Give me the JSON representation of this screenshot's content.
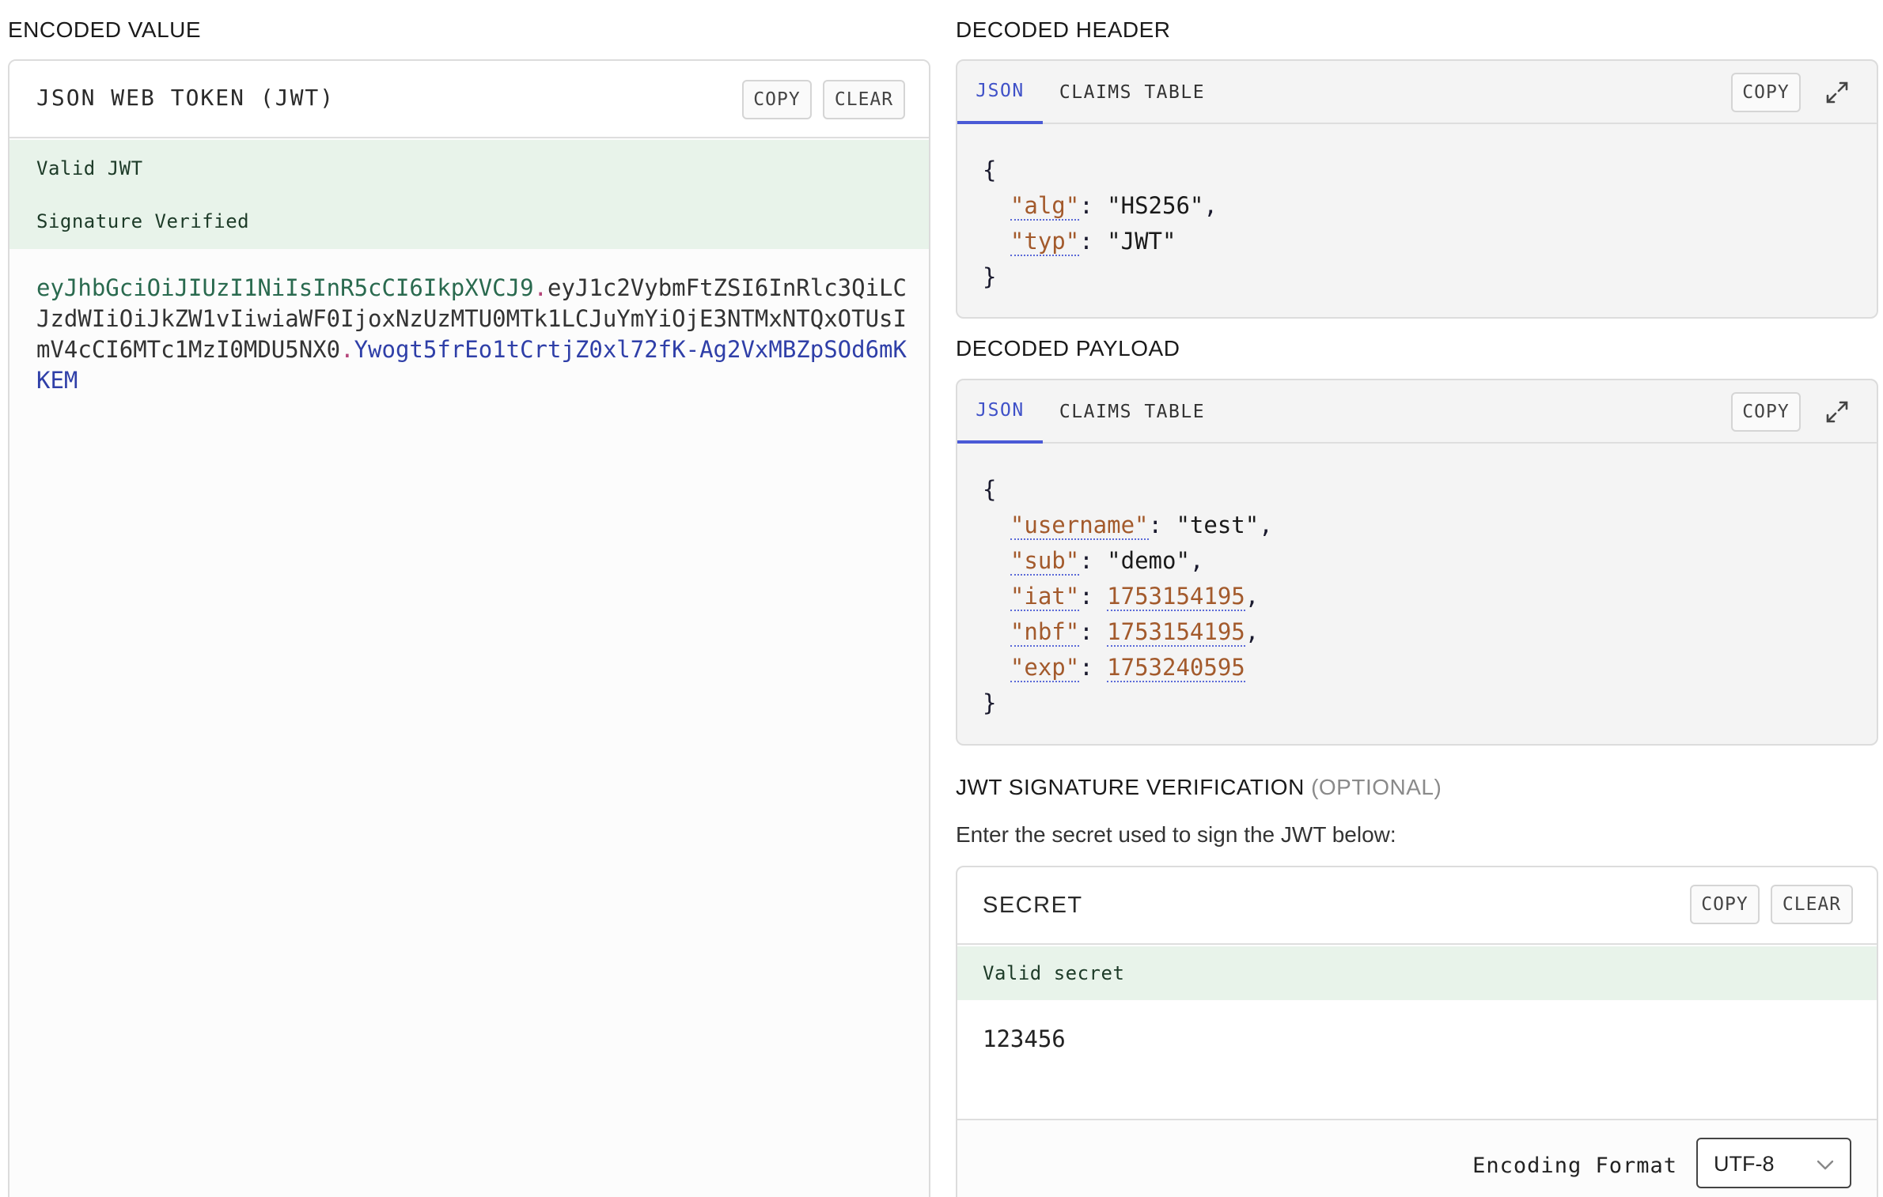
{
  "encoded": {
    "section_title": "ENCODED VALUE",
    "panel_title": "JSON WEB TOKEN (JWT)",
    "copy_label": "COPY",
    "clear_label": "CLEAR",
    "status_valid": "Valid JWT",
    "status_signature": "Signature Verified",
    "token_header": "eyJhbGciOiJIUzI1NiIsInR5cCI6IkpXVCJ9",
    "token_payload": "eyJ1c2VybmFtZSI6InRlc3QiLCJzdWIiOiJkZW1vIiwiaWF0IjoxNzUzMTU0MTk1LCJuYmYiOjE3NTMxNTQxOTUsImV4cCI6MTc1MzI0MDU5NX0",
    "token_signature": "Ywogt5frEo1tCrtjZ0xl72fK-Ag2VxMBZpSOd6mKKEM",
    "dot": "."
  },
  "header": {
    "section_title": "DECODED HEADER",
    "tab_json": "JSON",
    "tab_claims": "CLAIMS TABLE",
    "copy_label": "COPY",
    "open_brace": "{",
    "close_brace": "}",
    "fields": [
      {
        "key": "\"alg\"",
        "value": "\"HS256\"",
        "sep": ": ",
        "end": ","
      },
      {
        "key": "\"typ\"",
        "value": "\"JWT\"",
        "sep": ": ",
        "end": ""
      }
    ]
  },
  "payload": {
    "section_title": "DECODED PAYLOAD",
    "tab_json": "JSON",
    "tab_claims": "CLAIMS TABLE",
    "copy_label": "COPY",
    "open_brace": "{",
    "close_brace": "}",
    "fields": [
      {
        "key": "\"username\"",
        "value": "\"test\"",
        "sep": ": ",
        "end": ","
      },
      {
        "key": "\"sub\"",
        "value": "\"demo\"",
        "sep": ": ",
        "end": ","
      },
      {
        "key": "\"iat\"",
        "value": "1753154195",
        "sep": ": ",
        "end": ","
      },
      {
        "key": "\"nbf\"",
        "value": "1753154195",
        "sep": ": ",
        "end": ","
      },
      {
        "key": "\"exp\"",
        "value": "1753240595",
        "sep": ": ",
        "end": ""
      }
    ]
  },
  "verification": {
    "title": "JWT SIGNATURE VERIFICATION",
    "optional": "(OPTIONAL)",
    "instruction": "Enter the secret used to sign the JWT below:",
    "panel_title": "SECRET",
    "copy_label": "COPY",
    "clear_label": "CLEAR",
    "status": "Valid secret",
    "secret_value": "123456",
    "encoding_label": "Encoding Format",
    "encoding_value": "UTF-8"
  },
  "colors": {
    "accent": "#4a5ad6",
    "valid_bg": "#e8f3ea",
    "key_color": "#a35a2c",
    "token_header": "#2a6a4f",
    "token_signature": "#2f3fa8"
  }
}
